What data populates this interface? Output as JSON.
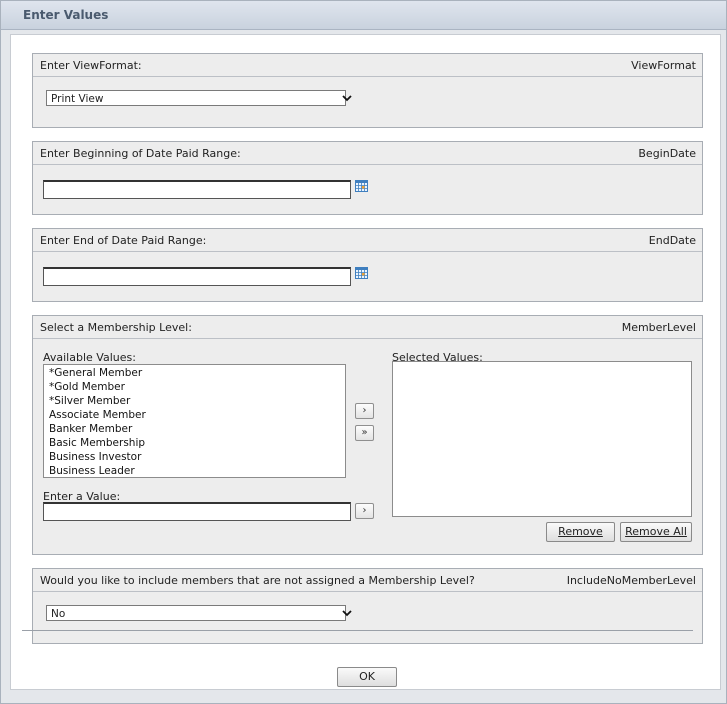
{
  "window": {
    "title": "Enter Values"
  },
  "view_format": {
    "prompt": "Enter ViewFormat:",
    "param_name": "ViewFormat",
    "selected": "Print View"
  },
  "begin_date": {
    "prompt": "Enter Beginning of Date Paid Range:",
    "param_name": "BeginDate",
    "value": ""
  },
  "end_date": {
    "prompt": "Enter End of Date Paid Range:",
    "param_name": "EndDate",
    "value": ""
  },
  "member_level": {
    "prompt": "Select a Membership Level:",
    "param_name": "MemberLevel",
    "available_label": "Available Values:",
    "selected_label": "Selected Values:",
    "available": [
      "*General Member",
      "*Gold Member",
      "*Silver Member",
      "Associate Member",
      "Banker Member",
      "Basic Membership",
      "Business Investor",
      "Business Leader"
    ],
    "selected": [],
    "enter_value_label": "Enter a Value:",
    "enter_value": "",
    "add_symbol": "›",
    "add_all_symbol": "»",
    "remove_label": "Remove",
    "remove_all_label": "Remove All"
  },
  "include_no_member": {
    "prompt": "Would you like to include members that are not assigned a Membership Level?",
    "param_name": "IncludeNoMemberLevel",
    "selected": "No"
  },
  "footer": {
    "ok_label": "OK"
  }
}
